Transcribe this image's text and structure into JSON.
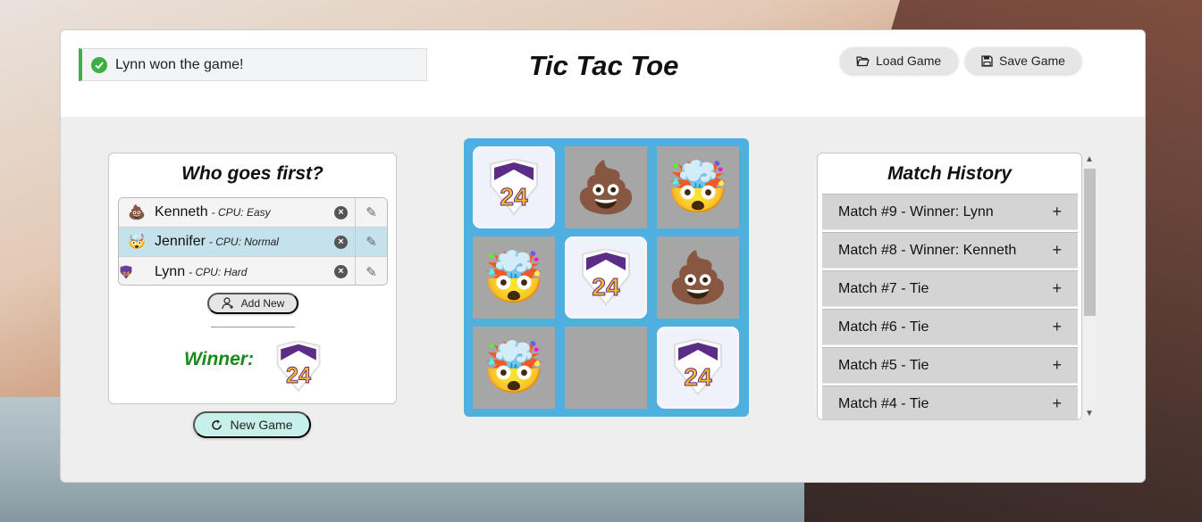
{
  "status": {
    "message": "Lynn won the game!"
  },
  "header": {
    "title": "Tic Tac Toe",
    "load_label": "Load Game",
    "save_label": "Save Game"
  },
  "players_panel": {
    "title": "Who goes first?",
    "players": [
      {
        "emoji": "💩",
        "name": "Kenneth",
        "cpu": "- CPU: Easy",
        "selected": false
      },
      {
        "emoji": "🤯",
        "name": "Jennifer",
        "cpu": "- CPU: Normal",
        "selected": true
      },
      {
        "emoji": "24",
        "name": "Lynn",
        "cpu": "- CPU: Hard",
        "selected": false
      }
    ],
    "add_new_label": "Add New",
    "winner_label": "Winner:"
  },
  "new_game_label": "New Game",
  "board": {
    "cells": [
      "24",
      "💩",
      "🤯",
      "🤯",
      "24",
      "💩",
      "🤯",
      "",
      "24"
    ],
    "winning": [
      0,
      4,
      8
    ]
  },
  "history": {
    "title": "Match History",
    "matches": [
      "Match #9 - Winner: Lynn",
      "Match #8 - Winner: Kenneth",
      "Match #7 - Tie",
      "Match #6 - Tie",
      "Match #5 - Tie",
      "Match #4 - Tie"
    ],
    "expand_symbol": "+"
  },
  "colors": {
    "board_bg": "#4fb0e0",
    "winner_text": "#1a8a1a",
    "status_accent": "#3cb043",
    "selected_row": "#c4e1ec"
  },
  "icons": {
    "status": "check-circle-icon",
    "load": "folder-open-icon",
    "save": "floppy-disk-icon",
    "add": "user-plus-icon",
    "new_game": "refresh-icon",
    "remove": "close-circle-icon",
    "edit": "pencil-icon"
  }
}
